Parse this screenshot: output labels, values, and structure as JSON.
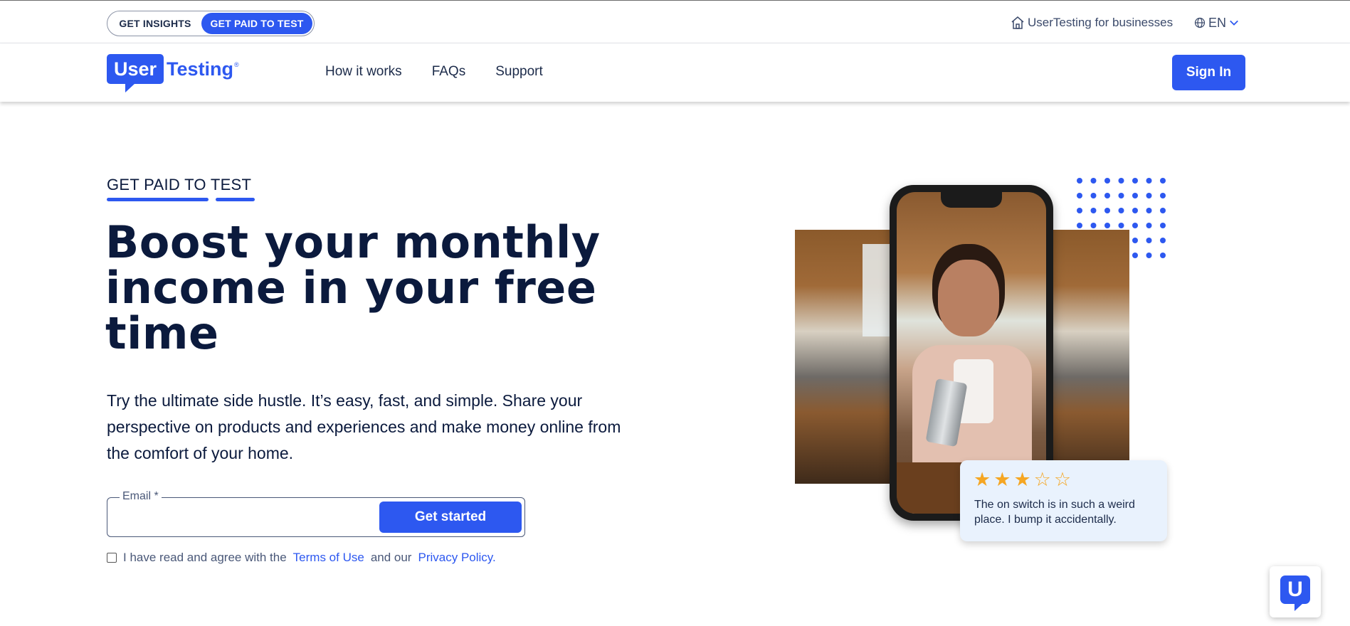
{
  "utility_bar": {
    "toggle": {
      "inactive_label": "GET INSIGHTS",
      "active_label": "GET PAID TO TEST"
    },
    "business_link": "UserTesting for businesses",
    "business_icon": "home-icon",
    "language": "EN",
    "language_icon": "globe-icon"
  },
  "nav": {
    "logo": {
      "part1": "User",
      "part2": "Testing",
      "reg": "®"
    },
    "links": [
      "How it works",
      "FAQs",
      "Support"
    ],
    "sign_in": "Sign In"
  },
  "hero": {
    "eyebrow": "GET PAID TO TEST",
    "headline": "Boost your monthly income in your free time",
    "subcopy": "Try the ultimate side hustle. It’s easy, fast, and simple. Share your perspective on products and experiences and make money online from the comfort of your home.",
    "email": {
      "label": "Email *",
      "value": "",
      "placeholder": ""
    },
    "cta": "Get started",
    "consent": {
      "prefix": "I have read and agree with the",
      "terms": "Terms of Use",
      "middle": "and our",
      "privacy": "Privacy Policy.",
      "checked": false
    }
  },
  "review": {
    "rating": 3,
    "max_rating": 5,
    "text": "The on switch is in such a weird place. I bump it accidentally."
  },
  "chat_widget": {
    "letter": "U"
  },
  "colors": {
    "brand": "#2d58f0",
    "ink": "#0b1a3d",
    "star": "#f5a623",
    "card": "#e9f2fd"
  }
}
